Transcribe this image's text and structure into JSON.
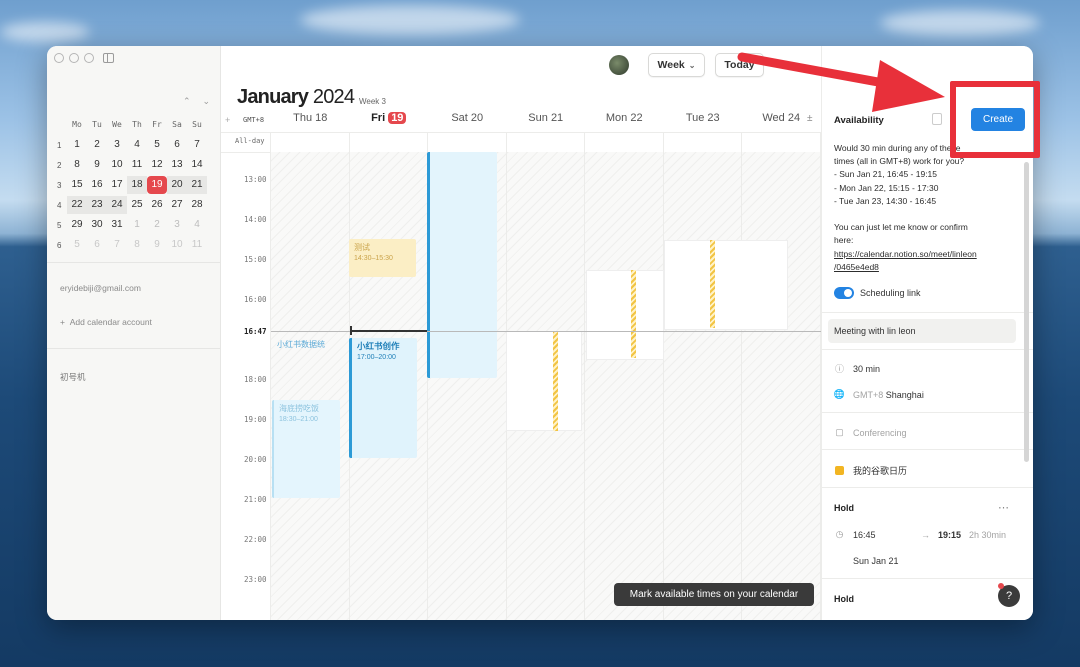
{
  "sidebar": {
    "mini_calendar": {
      "weekday_headers": [
        "Mo",
        "Tu",
        "We",
        "Th",
        "Fr",
        "Sa",
        "Su"
      ],
      "weeks": [
        {
          "num": "1",
          "days": [
            "1",
            "2",
            "3",
            "4",
            "5",
            "6",
            "7"
          ]
        },
        {
          "num": "2",
          "days": [
            "8",
            "9",
            "10",
            "11",
            "12",
            "13",
            "14"
          ]
        },
        {
          "num": "3",
          "days": [
            "15",
            "16",
            "17",
            "18",
            "19",
            "20",
            "21"
          ]
        },
        {
          "num": "4",
          "days": [
            "22",
            "23",
            "24",
            "25",
            "26",
            "27",
            "28"
          ]
        },
        {
          "num": "5",
          "days": [
            "29",
            "30",
            "31",
            "1",
            "2",
            "3",
            "4"
          ]
        },
        {
          "num": "6",
          "days": [
            "5",
            "6",
            "7",
            "8",
            "9",
            "10",
            "11"
          ]
        }
      ]
    },
    "account_email": "eryidebiji@gmail.com",
    "add_account_label": "Add calendar account",
    "calendar_name": "初号机"
  },
  "header": {
    "month": "January",
    "year": "2024",
    "week_label": "Week 3",
    "view_label": "Week",
    "today_label": "Today"
  },
  "grid": {
    "timezone_label": "GMT+8",
    "allday_label": "All-day",
    "day_columns": [
      {
        "name": "Thu",
        "num": "18"
      },
      {
        "name": "Fri",
        "num": "19",
        "today": true
      },
      {
        "name": "Sat",
        "num": "20"
      },
      {
        "name": "Sun",
        "num": "21"
      },
      {
        "name": "Mon",
        "num": "22"
      },
      {
        "name": "Tue",
        "num": "23"
      },
      {
        "name": "Wed",
        "num": "24"
      }
    ],
    "hours": [
      "13:00",
      "14:00",
      "15:00",
      "16:00",
      "18:00",
      "19:00",
      "20:00",
      "21:00",
      "22:00",
      "23:00"
    ],
    "now_label": "16:47",
    "events": {
      "test_title": "测试",
      "test_time": "14:30–15:30",
      "data_title": "小红书数据统",
      "create_title": "小红书创作",
      "create_time": "17:00–20:00",
      "hotpot_title": "海底捞吃饭",
      "hotpot_time": "18:30–21:00"
    },
    "tooltip": "Mark available times on your calendar"
  },
  "panel": {
    "title": "Availability",
    "create_label": "Create",
    "message_lines": [
      "Would 30 min during any of these",
      "times (all in GMT+8) work for you?",
      "- Sun Jan 21, 16:45 - 19:15",
      "- Mon Jan 22, 15:15 - 17:30",
      "- Tue Jan 23, 14:30 - 16:45",
      "",
      "You can just let me know or confirm",
      "here:"
    ],
    "link_lines": [
      "https://calendar.notion.so/meet/linleon",
      "/0465e4ed8"
    ],
    "scheduling_link_label": "Scheduling link",
    "meeting_title": "Meeting with lin leon",
    "duration": "30 min",
    "tz_prefix": "GMT+8",
    "tz_city": "Shanghai",
    "conferencing": "Conferencing",
    "calendar": "我的谷歌日历",
    "hold_label": "Hold",
    "hold2_label": "Hold",
    "hold_start": "16:45",
    "hold_end": "19:15",
    "hold_duration": "2h 30min",
    "hold_date": "Sun Jan 21"
  },
  "colors": {
    "accent": "#2383e2",
    "today_red": "#e5484d",
    "annotation_red": "#e8303a"
  }
}
